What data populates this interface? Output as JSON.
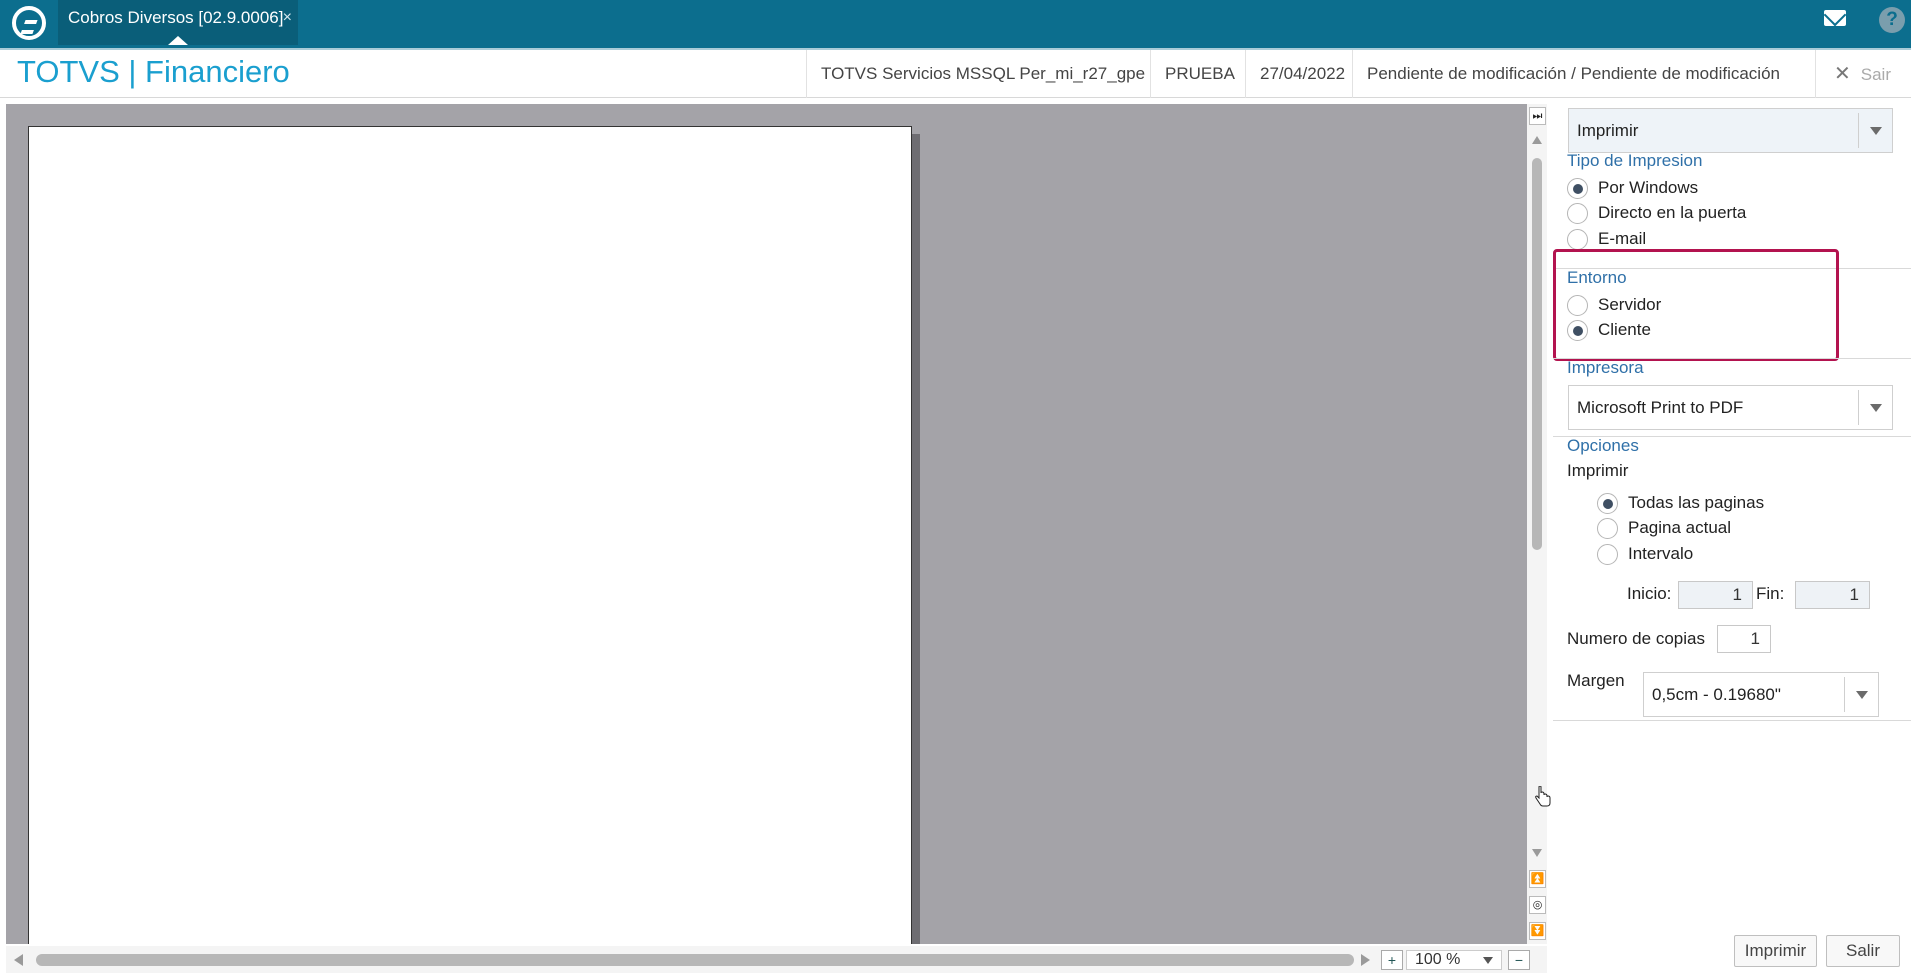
{
  "topbar": {
    "tab_label": "Cobros Diversos [02.9.0006]",
    "tab_close": "×",
    "help_label": "?"
  },
  "header": {
    "app_title": "TOTVS | Financiero",
    "environment": "TOTVS Servicios MSSQL Per_mi_r27_gpe",
    "company": "PRUEBA",
    "date": "27/04/2022",
    "status": "Pendiente de modificación / Pendiente de modificación",
    "exit_label": "Sair",
    "exit_icon": "✕"
  },
  "preview": {
    "zoom": "100 %",
    "zoom_in_icon": "+",
    "zoom_out_icon": "−",
    "nav_icons": {
      "collapse": "⏭",
      "first": "⏫",
      "center": "◎",
      "last": "⏬"
    }
  },
  "panel": {
    "action_select": "Imprimir",
    "print_type": {
      "title": "Tipo de Impresion",
      "options": [
        "Por Windows",
        "Directo en la puerta",
        "E-mail"
      ],
      "selected": 0
    },
    "environment": {
      "title": "Entorno",
      "options": [
        "Servidor",
        "Cliente"
      ],
      "selected": 1
    },
    "printer": {
      "title": "Impresora",
      "value": "Microsoft Print to PDF"
    },
    "options": {
      "title": "Opciones",
      "print_label": "Imprimir",
      "pages": [
        "Todas las paginas",
        "Pagina actual",
        "Intervalo"
      ],
      "selected": 0,
      "start_label": "Inicio:",
      "start_value": "1",
      "end_label": "Fin:",
      "end_value": "1",
      "copies_label": "Numero de copias",
      "copies_value": "1",
      "margin_label": "Margen",
      "margin_value": "0,5cm - 0.19680\""
    },
    "buttons": {
      "print": "Imprimir",
      "exit": "Salir"
    }
  },
  "colors": {
    "topbar": "#0c6e8e",
    "title": "#1a9fcf",
    "group_title": "#2f70a8",
    "highlight": "#b3134f",
    "preview_bg": "#a4a3a8"
  }
}
